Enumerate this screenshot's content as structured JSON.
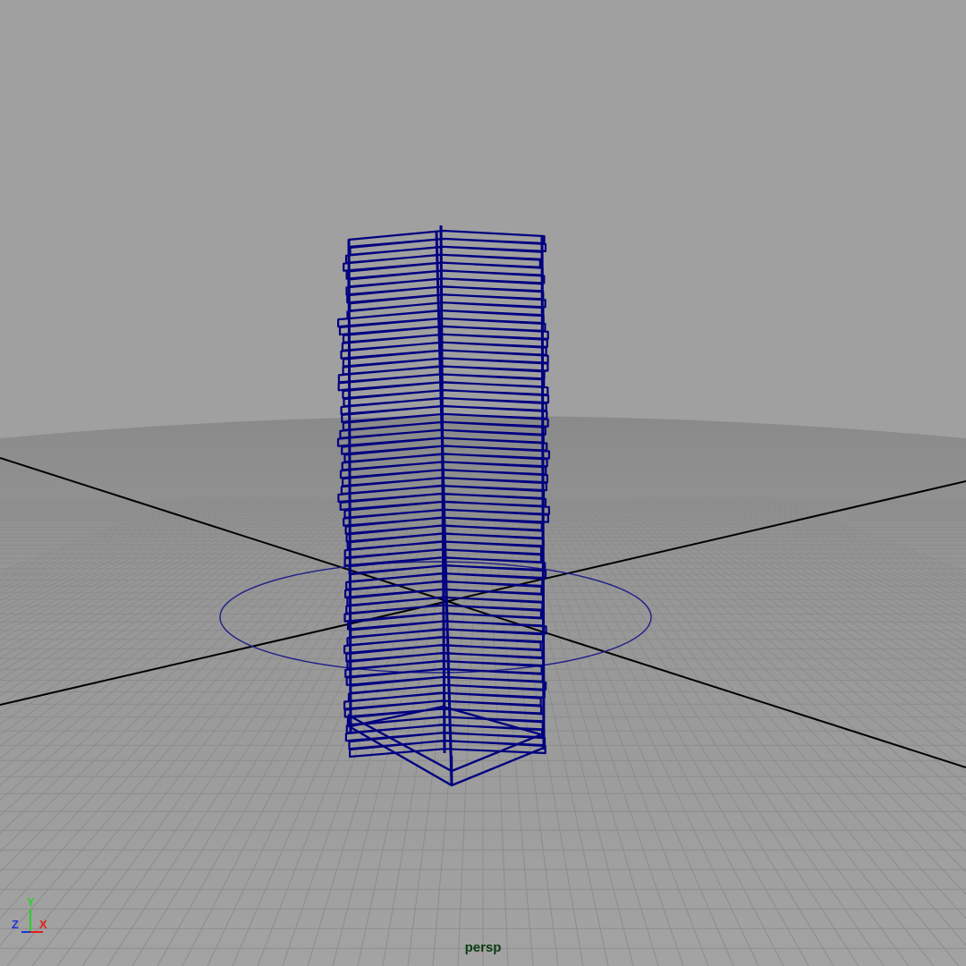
{
  "viewport": {
    "camera_name": "persp",
    "background_color": "#a0a0a0",
    "ground_color": "#999999",
    "grid_line_color": "#8c8c8c",
    "axis_line_color": "#000000",
    "wireframe_color": "#000080",
    "manipulator_ring_color": "#1d1d8a",
    "camera_label_color": "#0b3d12"
  },
  "axis_gizmo": {
    "x_label": "X",
    "y_label": "Y",
    "z_label": "Z",
    "x_color": "#e0201a",
    "y_color": "#2ad12a",
    "z_color": "#2033d8"
  },
  "selected_object": {
    "type": "stacked-box-wireframe",
    "icon": "polygon-tower"
  }
}
